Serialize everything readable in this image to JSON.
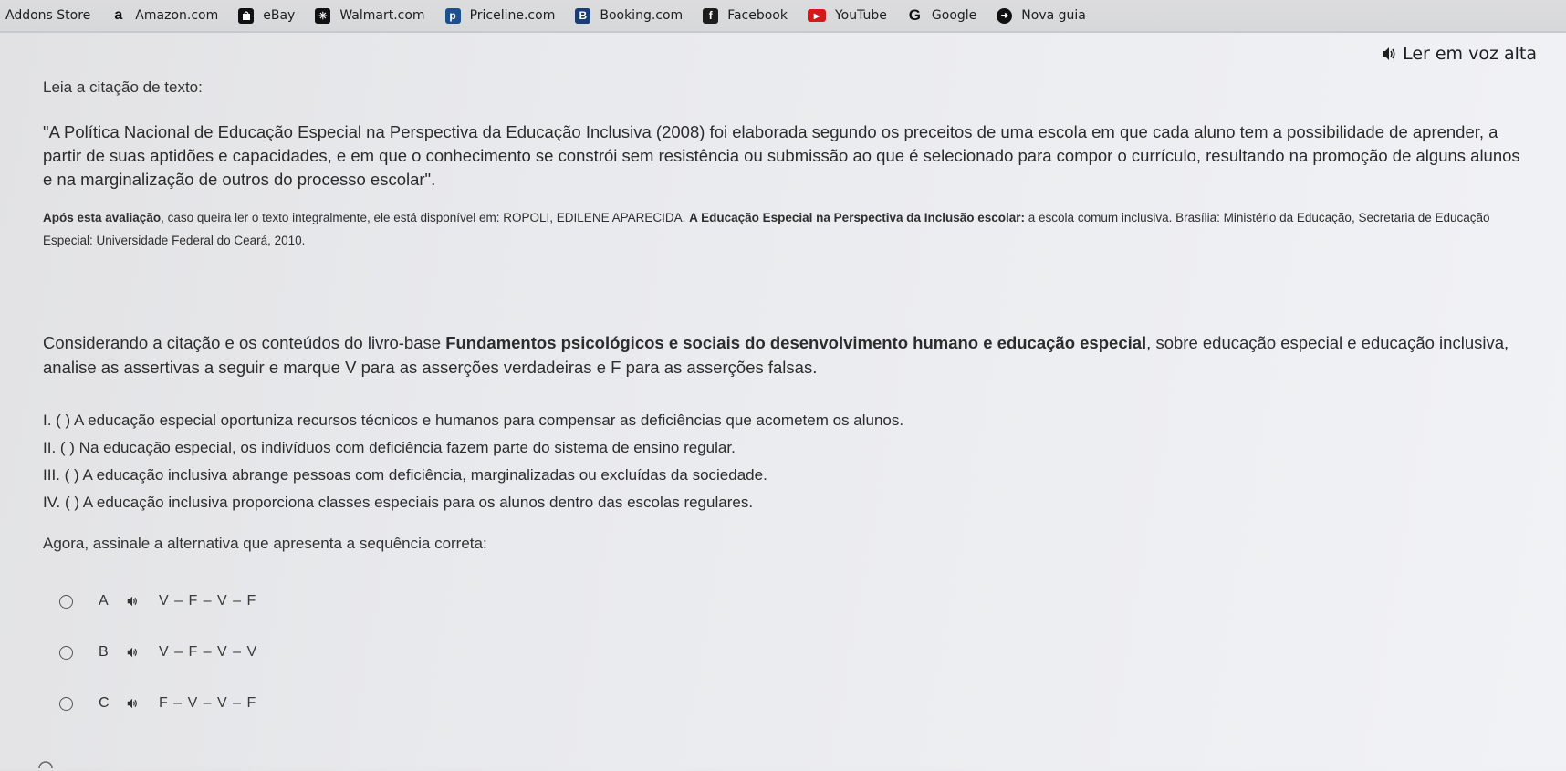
{
  "bookmarks": [
    {
      "label": "Addons Store",
      "icon": "none",
      "color": ""
    },
    {
      "label": "Amazon.com",
      "icon": "amazon-icon",
      "color": "#111111"
    },
    {
      "label": "eBay",
      "icon": "ebay-icon",
      "color": "#111111"
    },
    {
      "label": "Walmart.com",
      "icon": "walmart-icon",
      "color": "#111111"
    },
    {
      "label": "Priceline.com",
      "icon": "priceline-icon",
      "color": "#1d4f8c"
    },
    {
      "label": "Booking.com",
      "icon": "booking-icon",
      "color": "#1a3d73"
    },
    {
      "label": "Facebook",
      "icon": "facebook-icon",
      "color": "#1d1d1d"
    },
    {
      "label": "YouTube",
      "icon": "youtube-icon",
      "color": "#d11a1a"
    },
    {
      "label": "Google",
      "icon": "google-icon",
      "color": "#111111"
    },
    {
      "label": "Nova guia",
      "icon": "new-tab-icon",
      "color": "#111111"
    }
  ],
  "read_aloud": "Ler em voz alta",
  "intro": "Leia a citação de texto:",
  "quote": "\"A Política Nacional de Educação Especial na Perspectiva da Educação Inclusiva (2008) foi elaborada segundo os preceitos de uma escola em que cada aluno tem a possibilidade de aprender, a partir de suas aptidões e capacidades, e em que o conhecimento se constrói sem resistência ou submissão ao que é selecionado para compor o currículo, resultando na promoção de alguns alunos e na marginalização de outros do processo escolar\".",
  "source": {
    "bold_prefix": "Após esta avaliação",
    "text1": ", caso queira ler o texto integralmente, ele está disponível em: ROPOLI, EDILENE APARECIDA. ",
    "bold_title": "A Educação Especial na Perspectiva da Inclusão escolar:",
    "text2": " a escola comum inclusiva. Brasília: Ministério da Educação, Secretaria de Educação Especial: Universidade Federal do Ceará, 2010."
  },
  "context": {
    "text1": "Considerando a citação e os conteúdos do livro-base ",
    "bold": "Fundamentos psicológicos e sociais do desenvolvimento humano e educação especial",
    "text2": ", sobre educação especial e educação inclusiva, analise as assertivas a seguir e marque V para as asserções verdadeiras e F para as asserções falsas."
  },
  "statements": [
    "I. ( ) A educação especial oportuniza recursos técnicos e humanos para compensar as deficiências que acometem os alunos.",
    "II. ( ) Na educação especial, os indivíduos com deficiência fazem parte do sistema de ensino regular.",
    "III. ( ) A educação inclusiva abrange pessoas com deficiência, marginalizadas ou excluídas da sociedade.",
    "IV. ( ) A educação inclusiva proporciona classes especiais para os alunos dentro das escolas regulares."
  ],
  "instruction": "Agora, assinale a alternativa que apresenta a sequência correta:",
  "options": [
    {
      "letter": "A",
      "text": "V – F – V – F"
    },
    {
      "letter": "B",
      "text": "V – F – V – V"
    },
    {
      "letter": "C",
      "text": "F – V – V – F"
    }
  ]
}
